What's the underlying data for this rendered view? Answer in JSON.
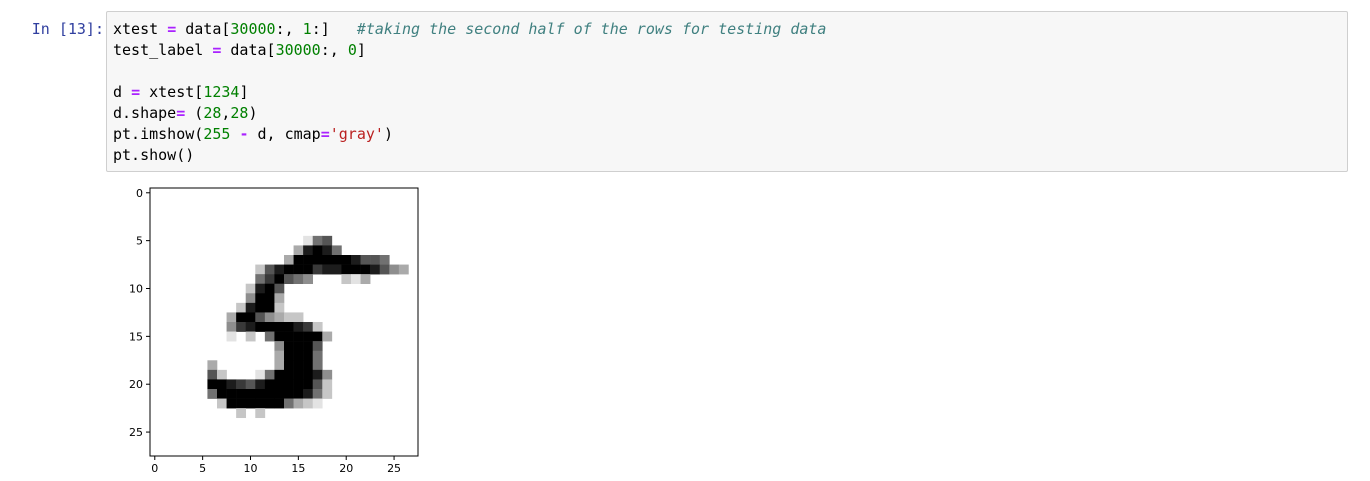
{
  "cell": {
    "prompt": "In [13]:",
    "code_lines": [
      [
        {
          "t": "xtest ",
          "c": ""
        },
        {
          "t": "=",
          "c": "op"
        },
        {
          "t": " data[",
          "c": ""
        },
        {
          "t": "30000",
          "c": "num"
        },
        {
          "t": ":, ",
          "c": ""
        },
        {
          "t": "1",
          "c": "num"
        },
        {
          "t": ":]   ",
          "c": ""
        },
        {
          "t": "#taking the second half of the rows for testing data",
          "c": "com"
        }
      ],
      [
        {
          "t": "test_label ",
          "c": ""
        },
        {
          "t": "=",
          "c": "op"
        },
        {
          "t": " data[",
          "c": ""
        },
        {
          "t": "30000",
          "c": "num"
        },
        {
          "t": ":, ",
          "c": ""
        },
        {
          "t": "0",
          "c": "num"
        },
        {
          "t": "]",
          "c": ""
        }
      ],
      [],
      [
        {
          "t": "d ",
          "c": ""
        },
        {
          "t": "=",
          "c": "op"
        },
        {
          "t": " xtest[",
          "c": ""
        },
        {
          "t": "1234",
          "c": "num"
        },
        {
          "t": "]",
          "c": ""
        }
      ],
      [
        {
          "t": "d.shape",
          "c": ""
        },
        {
          "t": "=",
          "c": "op"
        },
        {
          "t": " (",
          "c": ""
        },
        {
          "t": "28",
          "c": "num"
        },
        {
          "t": ",",
          "c": ""
        },
        {
          "t": "28",
          "c": "num"
        },
        {
          "t": ")",
          "c": ""
        }
      ],
      [
        {
          "t": "pt.imshow(",
          "c": ""
        },
        {
          "t": "255",
          "c": "num"
        },
        {
          "t": " ",
          "c": ""
        },
        {
          "t": "-",
          "c": "op"
        },
        {
          "t": " d, cmap",
          "c": ""
        },
        {
          "t": "=",
          "c": "op"
        },
        {
          "t": "'gray'",
          "c": "str"
        },
        {
          "t": ")",
          "c": ""
        }
      ],
      [
        {
          "t": "pt.show()",
          "c": ""
        }
      ]
    ]
  },
  "colors": {
    "prompt": "#303f9f",
    "keyword": "#aa22ff",
    "number": "#008000",
    "string": "#ba2121",
    "comment": "#408080",
    "cell_bg": "#f7f7f7",
    "cell_border": "#cfcfcf"
  },
  "chart_data": {
    "type": "heatmap",
    "title": "",
    "xlabel": "",
    "ylabel": "",
    "cmap": "gray",
    "xticks": [
      0,
      5,
      10,
      15,
      20,
      25
    ],
    "yticks": [
      0,
      5,
      10,
      15,
      20,
      25
    ],
    "xlim": [
      -0.5,
      27.5
    ],
    "ylim": [
      27.5,
      -0.5
    ],
    "grid": false,
    "image_rows": [
      "............................",
      "............................",
      "............................",
      "............................",
      "............................",
      "................156.........",
      "...............38985.........",
      "..............39999998665....",
      "...........2689997889998643.",
      "...........579654...213......",
      "..........2896...............",
      "..........4993...............",
      ".........28992...............",
      "........39964322.............",
      "........4789999872...........",
      "........1.2.5999993..........",
      ".............49996...........",
      ".............39995...........",
      "......3......39995...........",
      "......62...15999984..........",
      "......9987689999962..........",
      "......5999999999852..........",
      ".......29999995321...........",
      ".........2.2..................",
      "............................",
      "............................",
      "............................",
      "............................"
    ]
  }
}
